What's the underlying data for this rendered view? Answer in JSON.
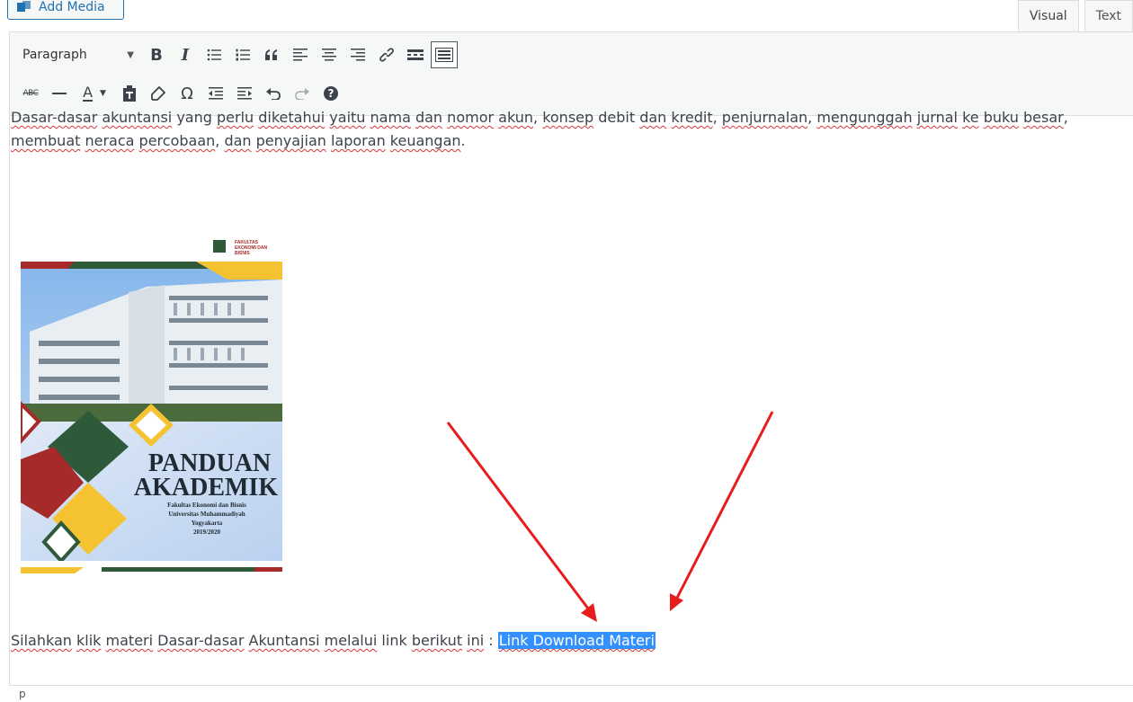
{
  "header": {
    "add_media_label": "Add Media",
    "tabs": [
      {
        "label": "Visual",
        "active": true
      },
      {
        "label": "Text",
        "active": false
      }
    ]
  },
  "toolbar": {
    "format_select_value": "Paragraph",
    "row1_icons": [
      "bold-icon",
      "italic-icon",
      "bulleted-list-icon",
      "numbered-list-icon",
      "blockquote-icon",
      "align-left-icon",
      "align-center-icon",
      "align-right-icon",
      "insert-link-icon",
      "read-more-icon",
      "toolbar-toggle-icon"
    ],
    "row2_icons": [
      "strikethrough-icon",
      "horizontal-line-icon",
      "text-color-icon",
      "paste-as-text-icon",
      "clear-formatting-icon",
      "special-character-icon",
      "outdent-icon",
      "indent-icon",
      "undo-icon",
      "redo-icon",
      "keyboard-shortcuts-icon"
    ],
    "bold_glyph": "B",
    "italic_glyph": "I",
    "strike_glyph": "ABC",
    "text_color_glyph": "A",
    "omega_glyph": "Ω",
    "help_glyph": "?"
  },
  "content": {
    "paragraph1": [
      {
        "t": "Dasar-dasar",
        "s": true
      },
      {
        "t": " "
      },
      {
        "t": "akuntansi",
        "s": true
      },
      {
        "t": " yang "
      },
      {
        "t": "perlu",
        "s": true
      },
      {
        "t": " "
      },
      {
        "t": "diketahui",
        "s": true
      },
      {
        "t": " "
      },
      {
        "t": "yaitu",
        "s": true
      },
      {
        "t": " "
      },
      {
        "t": "nama",
        "s": true
      },
      {
        "t": " "
      },
      {
        "t": "dan",
        "s": true
      },
      {
        "t": " "
      },
      {
        "t": "nomor",
        "s": true
      },
      {
        "t": " "
      },
      {
        "t": "akun",
        "s": true
      },
      {
        "t": ", "
      },
      {
        "t": "konsep",
        "s": true
      },
      {
        "t": " debit "
      },
      {
        "t": "dan",
        "s": true
      },
      {
        "t": " "
      },
      {
        "t": "kredit",
        "s": true
      },
      {
        "t": ", "
      },
      {
        "t": "penjurnalan",
        "s": true
      },
      {
        "t": ", "
      },
      {
        "t": "mengunggah",
        "s": true
      },
      {
        "t": " "
      },
      {
        "t": "jurnal",
        "s": true
      },
      {
        "t": " "
      },
      {
        "t": "ke",
        "s": true
      },
      {
        "t": " "
      },
      {
        "t": "buku",
        "s": true
      },
      {
        "t": " "
      },
      {
        "t": "besar",
        "s": true
      },
      {
        "t": ", "
      },
      {
        "t": "membuat",
        "s": true
      },
      {
        "t": " "
      },
      {
        "t": "neraca",
        "s": true
      },
      {
        "t": " "
      },
      {
        "t": "percobaan",
        "s": true
      },
      {
        "t": ", "
      },
      {
        "t": "dan",
        "s": true
      },
      {
        "t": " "
      },
      {
        "t": "penyajian",
        "s": true
      },
      {
        "t": " "
      },
      {
        "t": "laporan",
        "s": true
      },
      {
        "t": " "
      },
      {
        "t": "keuangan",
        "s": true
      },
      {
        "t": "."
      }
    ],
    "paragraph2": [
      {
        "t": "Silahkan",
        "s": true
      },
      {
        "t": " "
      },
      {
        "t": "klik",
        "s": true
      },
      {
        "t": " "
      },
      {
        "t": "materi",
        "s": true
      },
      {
        "t": " "
      },
      {
        "t": "Dasar-dasar",
        "s": true
      },
      {
        "t": " "
      },
      {
        "t": "Akuntansi",
        "s": true
      },
      {
        "t": " "
      },
      {
        "t": "melalui",
        "s": true
      },
      {
        "t": " link "
      },
      {
        "t": "berikut",
        "s": true
      },
      {
        "t": " "
      },
      {
        "t": "ini",
        "s": true
      },
      {
        "t": " : "
      }
    ],
    "selected_link_text": "Link Download Materi",
    "image": {
      "logo_text_1": "FAKULTAS",
      "logo_text_2": "EKONOMI DAN",
      "logo_text_3": "BISNIS",
      "title_1": "PANDUAN",
      "title_2": "AKADEMIK",
      "subtitle_1": "Fakultas Ekonomi dan Bisnis",
      "subtitle_2": "Universitas Muhammadiyah",
      "subtitle_3": "Yogyakarta",
      "subtitle_4": "2019/2020",
      "colors": {
        "green": "#2e5a3a",
        "red": "#a62a2a",
        "yellow": "#f5c232",
        "sky": "#b9d3f0"
      }
    }
  },
  "statusbar": {
    "path": "p"
  },
  "annotations": {
    "arrow_color": "#e81c1c"
  }
}
